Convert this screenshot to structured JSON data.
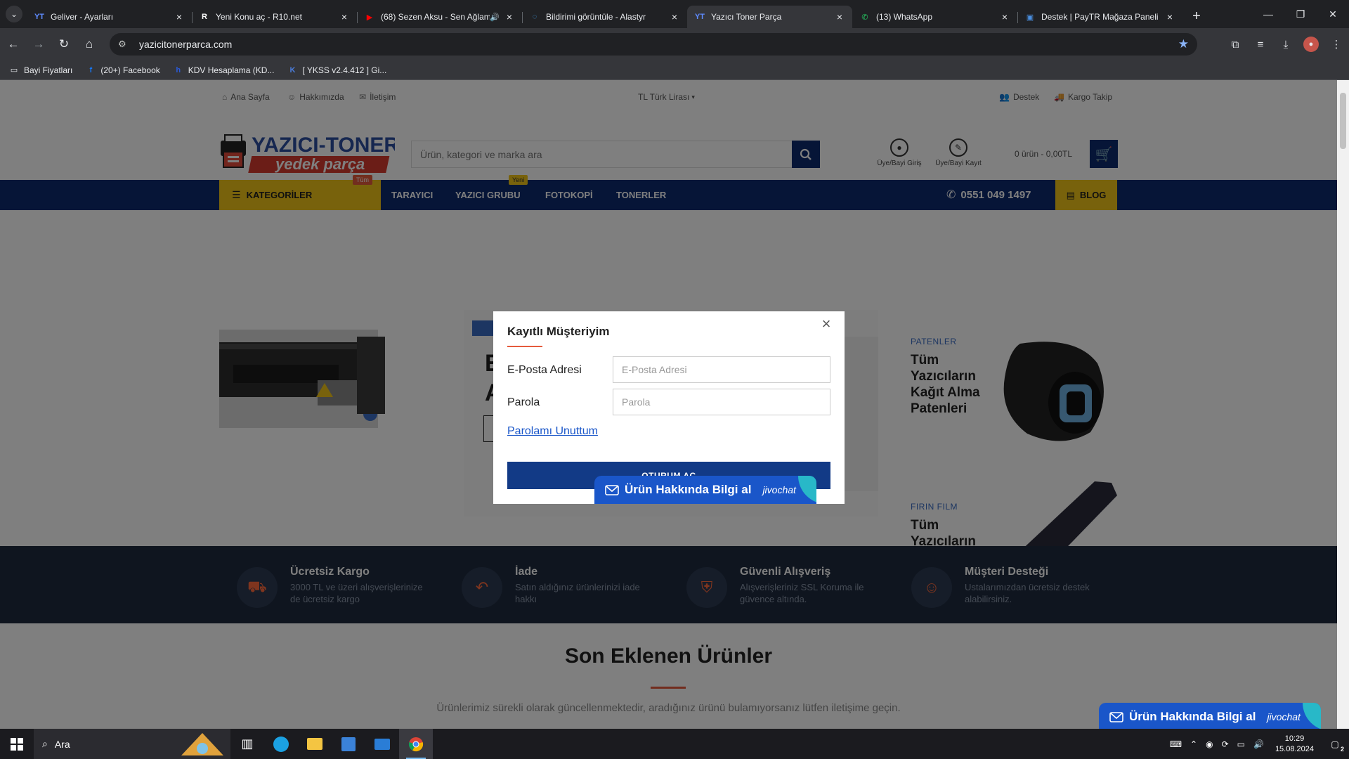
{
  "browser": {
    "tabs": [
      {
        "title": "Geliver - Ayarları",
        "favicon": "YT",
        "favicon_color": "#5e8bff",
        "active": false,
        "audio": false
      },
      {
        "title": "Yeni Konu aç - R10.net",
        "favicon": "R",
        "favicon_color": "#ffffff",
        "active": false,
        "audio": false
      },
      {
        "title": "(68) Sezen Aksu - Sen Ağlama",
        "favicon": "▶",
        "favicon_color": "#ff0000",
        "active": false,
        "audio": true
      },
      {
        "title": "Bildirimi görüntüle - Alastyr",
        "favicon": "◌",
        "favicon_color": "#42a5f5",
        "active": false,
        "audio": false
      },
      {
        "title": "Yazıcı Toner Parça",
        "favicon": "YT",
        "favicon_color": "#5e8bff",
        "active": true,
        "audio": false
      },
      {
        "title": "(13) WhatsApp",
        "favicon": "✆",
        "favicon_color": "#25d366",
        "active": false,
        "audio": false
      },
      {
        "title": "Destek | PayTR Mağaza Paneli",
        "favicon": "▣",
        "favicon_color": "#4a90e2",
        "active": false,
        "audio": false
      }
    ],
    "url": "yazicitonerparca.com",
    "bookmarks": [
      {
        "label": "Bayi Fiyatları",
        "icon": "folder-icon",
        "glyph": "▭",
        "color": "#e8eaed"
      },
      {
        "label": "(20+) Facebook",
        "icon": "facebook-icon",
        "glyph": "f",
        "color": "#1877f2"
      },
      {
        "label": "KDV Hesaplama (KD...",
        "icon": "kdv-icon",
        "glyph": "h",
        "color": "#2a5ad8"
      },
      {
        "label": "[ YKSS v2.4.412 ] Gi...",
        "icon": "ykss-icon",
        "glyph": "K",
        "color": "#4a7bd8"
      }
    ]
  },
  "site": {
    "topbar": {
      "home": "Ana Sayfa",
      "about": "Hakkımızda",
      "contact": "İletişim",
      "currency": "TL Türk Lirası",
      "support": "Destek",
      "cargo": "Kargo Takip"
    },
    "logo": {
      "line1": "YAZICI-TONER",
      "line2": "yedek parça"
    },
    "search": {
      "placeholder": "Ürün, kategori ve marka ara"
    },
    "account": {
      "login": "Üye/Bayi Giriş",
      "register": "Üye/Bayi Kayıt"
    },
    "cart": {
      "total": "0 ürün - 0,00TL"
    },
    "nav": {
      "categories": "KATEGORİLER",
      "categories_badge": "Tüm",
      "links": [
        "TARAYICI",
        "YAZICI GRUBU",
        "FOTOKOPİ",
        "TONERLER"
      ],
      "new_badge": "Yeni",
      "phone": "0551 049 1497",
      "blog": "BLOG"
    },
    "promos": [
      {
        "kicker": "PATENLER",
        "title": "Tüm Yazıcıların Kağıt Alma Patenleri"
      },
      {
        "kicker": "FIRIN FILM",
        "title": "Tüm Yazıcıların Fırın Filmleri"
      }
    ],
    "slider_count": 4,
    "slider_active": 0,
    "features": [
      {
        "title": "Ücretsiz Kargo",
        "desc": "3000 TL ve üzeri alışverişlerinize de ücretsiz kargo",
        "icon": "truck-icon"
      },
      {
        "title": "İade",
        "desc": "Satın aldığınız ürünlerinizi iade hakkı",
        "icon": "return-icon"
      },
      {
        "title": "Güvenli Alışveriş",
        "desc": "Alışverişleriniz SSL Koruma ile güvence altında.",
        "icon": "shield-icon"
      },
      {
        "title": "Müşteri Desteği",
        "desc": "Ustalarımızdan ücretsiz destek alabilirsiniz.",
        "icon": "support-agent-icon"
      }
    ],
    "latest": {
      "title": "Son Eklenen Ürünler",
      "subtitle": "Ürünlerimiz sürekli olarak güncellenmektedir, aradığınız ürünü bulamıyorsanız lütfen iletişime geçin."
    }
  },
  "modal": {
    "title": "Kayıtlı Müşteriyim",
    "email_label": "E-Posta Adresi",
    "email_placeholder": "E-Posta Adresi",
    "email_value": "",
    "password_label": "Parola",
    "password_placeholder": "Parola",
    "password_value": "",
    "forgot": "Parolamı Unuttum",
    "submit": "OTURUM AÇ"
  },
  "chat": {
    "label": "Ürün Hakkında Bilgi al",
    "brand": "jivochat"
  },
  "taskbar": {
    "search": "Ara",
    "time": "10:29",
    "date": "15.08.2024",
    "notifications": "2"
  },
  "colors": {
    "brand_navy": "#0d2a6e",
    "accent_yellow": "#f0c419",
    "accent_red": "#e55a3c",
    "link": "#1a56c9",
    "chat": "#1a56c9"
  }
}
